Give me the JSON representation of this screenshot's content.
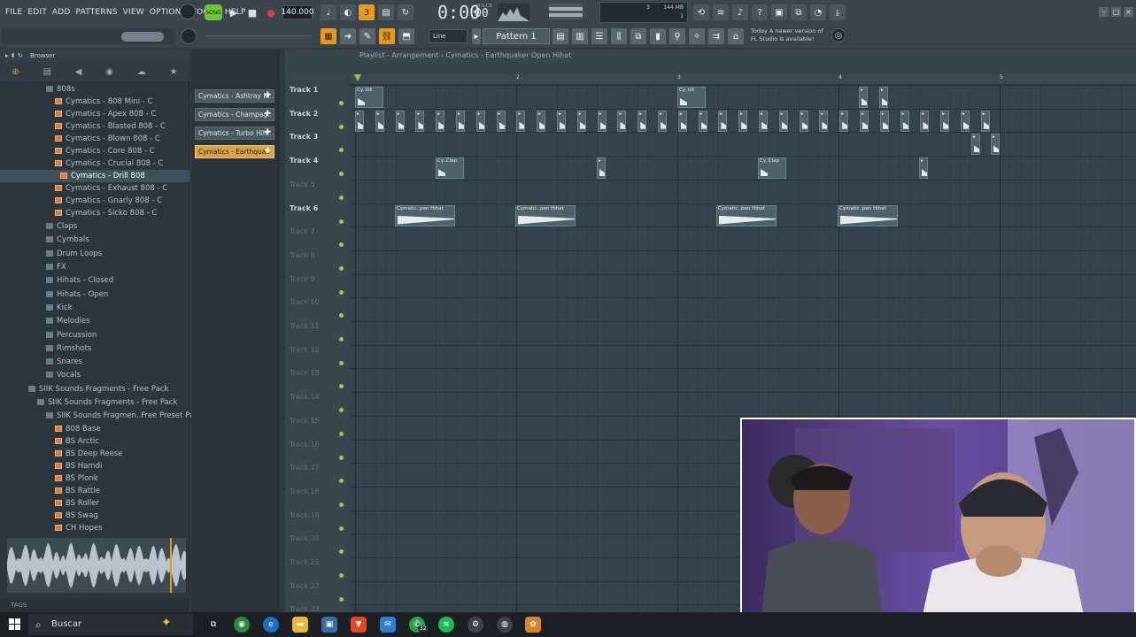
{
  "menu": [
    "FILE",
    "EDIT",
    "ADD",
    "PATTERNS",
    "VIEW",
    "OPTIONS",
    "TOOLS",
    "HELP"
  ],
  "transport": {
    "mode_label": "SONG",
    "tempo": "140.000",
    "time": "0:00",
    "time_sub": "00",
    "time_unit": "M:S:CS"
  },
  "monitor": {
    "cpu": "3",
    "mem": "144 MB",
    "voices": "1"
  },
  "toolbar2": {
    "snap": "Line",
    "pattern": "Pattern 1"
  },
  "news": {
    "line1": "Today  A newer version of",
    "line2": "FL Studio is available!"
  },
  "browser": {
    "title": "Browser",
    "items": [
      {
        "label": "808s",
        "depth": 2,
        "type": "folder"
      },
      {
        "label": "Cymatics - 808 Mini - C",
        "depth": 3,
        "type": "file"
      },
      {
        "label": "Cymatics - Apex 808 - C",
        "depth": 3,
        "type": "file"
      },
      {
        "label": "Cymatics - Blasted 808 - C",
        "depth": 3,
        "type": "file"
      },
      {
        "label": "Cymatics - Blown 808 - C",
        "depth": 3,
        "type": "file"
      },
      {
        "label": "Cymatics - Core 808 - C",
        "depth": 3,
        "type": "file"
      },
      {
        "label": "Cymatics - Crucial 808 - C",
        "depth": 3,
        "type": "file"
      },
      {
        "label": "Cymatics - Drill 808",
        "depth": 3,
        "type": "file",
        "selected": true
      },
      {
        "label": "Cymatics - Exhaust 808 - C",
        "depth": 3,
        "type": "file"
      },
      {
        "label": "Cymatics - Gnarly 808 - C",
        "depth": 3,
        "type": "file"
      },
      {
        "label": "Cymatics - Sicko 808 - C",
        "depth": 3,
        "type": "file"
      },
      {
        "label": "Claps",
        "depth": 2,
        "type": "folder"
      },
      {
        "label": "Cymbals",
        "depth": 2,
        "type": "folder"
      },
      {
        "label": "Drum Loops",
        "depth": 2,
        "type": "folder"
      },
      {
        "label": "FX",
        "depth": 2,
        "type": "folder"
      },
      {
        "label": "Hihats - Closed",
        "depth": 2,
        "type": "folder"
      },
      {
        "label": "Hihats - Open",
        "depth": 2,
        "type": "folder"
      },
      {
        "label": "Kick",
        "depth": 2,
        "type": "folder"
      },
      {
        "label": "Melodies",
        "depth": 2,
        "type": "folder"
      },
      {
        "label": "Percussion",
        "depth": 2,
        "type": "folder"
      },
      {
        "label": "Rimshots",
        "depth": 2,
        "type": "folder"
      },
      {
        "label": "Snares",
        "depth": 2,
        "type": "folder"
      },
      {
        "label": "Vocals",
        "depth": 2,
        "type": "folder"
      },
      {
        "label": "SIIK Sounds Fragments - Free Pack",
        "depth": 0,
        "type": "folder"
      },
      {
        "label": "SIIK Sounds Fragments - Free Pack",
        "depth": 1,
        "type": "folder"
      },
      {
        "label": "SIIK Sounds Fragmen..Free Preset Pack",
        "depth": 2,
        "type": "folder"
      },
      {
        "label": "808 Base",
        "depth": 3,
        "type": "file"
      },
      {
        "label": "BS Arctic",
        "depth": 3,
        "type": "file"
      },
      {
        "label": "BS Deep Reese",
        "depth": 3,
        "type": "file"
      },
      {
        "label": "BS Hamdi",
        "depth": 3,
        "type": "file"
      },
      {
        "label": "BS Plonk",
        "depth": 3,
        "type": "file"
      },
      {
        "label": "BS Rattle",
        "depth": 3,
        "type": "file"
      },
      {
        "label": "BS Roller",
        "depth": 3,
        "type": "file"
      },
      {
        "label": "BS Swag",
        "depth": 3,
        "type": "file"
      },
      {
        "label": "CH Hopes",
        "depth": 3,
        "type": "file"
      }
    ],
    "tags_label": "TAGS"
  },
  "picker": [
    {
      "label": "Cymatics - Ashtray Ki..",
      "selected": false
    },
    {
      "label": "Cymatics - Champag..",
      "selected": false
    },
    {
      "label": "Cymatics - Turbo Hih..",
      "selected": false
    },
    {
      "label": "Cymatics - Earthqua..",
      "selected": true
    }
  ],
  "playlist": {
    "title": "Playlist - Arrangement",
    "breadcrumb": "Cymatics - Earthquaker Open Hihat",
    "bars": [
      "2",
      "3",
      "4",
      "5"
    ],
    "tracks": [
      "Track 1",
      "Track 2",
      "Track 3",
      "Track 4",
      "Track 5",
      "Track 6",
      "Track 7",
      "Track 8",
      "Track 9",
      "Track 10",
      "Track 11",
      "Track 12",
      "Track 13",
      "Track 14",
      "Track 15",
      "Track 16",
      "Track 17",
      "Track 18",
      "Track 19",
      "Track 20",
      "Track 21",
      "Track 22",
      "Track 23"
    ],
    "clip_labels": {
      "kick": "Cy..ick",
      "clap": "Cy..Clap",
      "hihat": "Cymatic..pen Hihat"
    }
  },
  "taskbar": {
    "search_placeholder": "Buscar",
    "whatsapp_badge": "32"
  }
}
